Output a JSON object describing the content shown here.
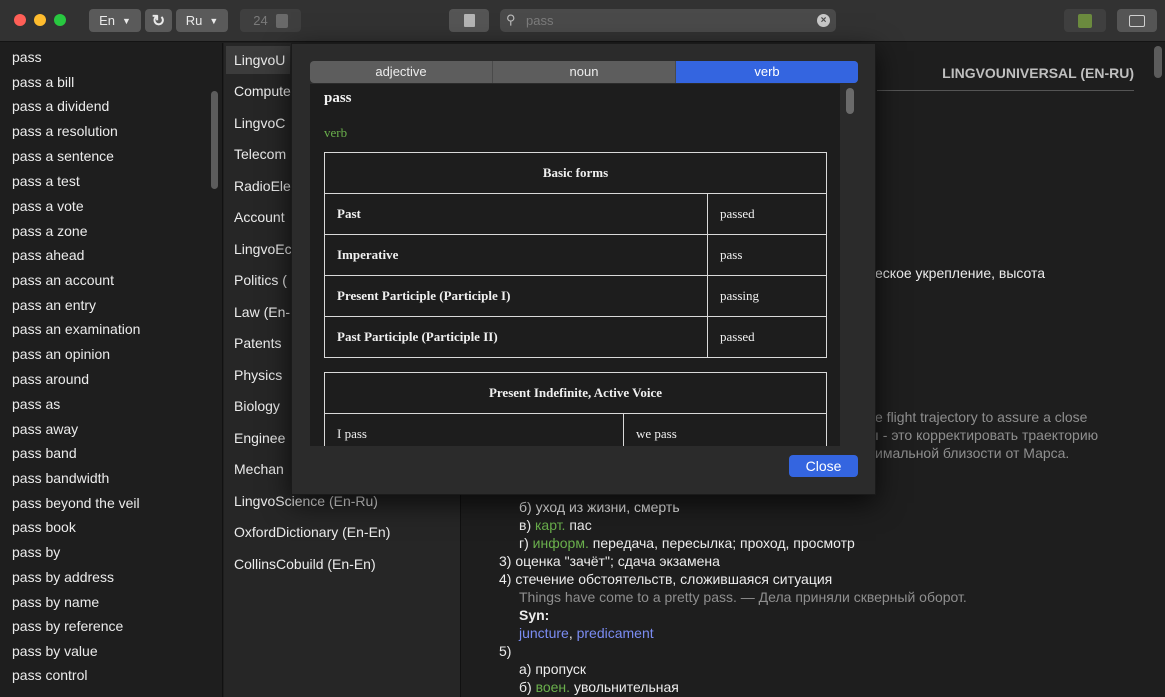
{
  "toolbar": {
    "source_lang": "En",
    "target_lang": "Ru",
    "font_size": "24",
    "search_value": "pass",
    "accent_color": "#3465e0"
  },
  "word_list": [
    "pass",
    "pass a bill",
    "pass a dividend",
    "pass a resolution",
    "pass a sentence",
    "pass a test",
    "pass a vote",
    "pass a zone",
    "pass ahead",
    "pass an account",
    "pass an entry",
    "pass an examination",
    "pass an opinion",
    "pass around",
    "pass as",
    "pass away",
    "pass band",
    "pass bandwidth",
    "pass beyond the veil",
    "pass book",
    "pass by",
    "pass by address",
    "pass by name",
    "pass by reference",
    "pass by value",
    "pass control"
  ],
  "dictionaries": [
    "LingvoU",
    "Compute",
    "LingvoC",
    "Telecom",
    "RadioEle",
    "Account",
    "LingvoEc",
    "Politics (",
    "Law (En-",
    "Patents",
    "Physics",
    "Biology",
    "Enginee",
    "Mechan",
    "LingvoScience (En-Ru)",
    "OxfordDictionary (En-En)",
    "CollinsCobuild (En-En)"
  ],
  "article": {
    "header": "LINGVOUNIVERSAL (EN-RU)",
    "frag1": "еское укрепление, высота",
    "frag2": "e flight trajectory to assure a close",
    "frag3": "ı - это корректировать траекторию",
    "frag4": "имальной близости от Марса.",
    "l_b": "б) уход из жизни, смерть",
    "l_v_label": "в) ",
    "l_v_tag": "карт.",
    "l_v_text": " пас",
    "l_g_label": "г) ",
    "l_g_tag": "информ.",
    "l_g_text": " передача, пересылка; проход, просмотр",
    "l3": "3) оценка \"зачёт\"; сдача экзамена",
    "l4": "4) стечение обстоятельств, сложившаяся ситуация",
    "example": "Things have come to a pretty pass. — Дела приняли скверный оборот.",
    "syn_label": "Syn:",
    "syn1": "juncture",
    "syn_sep": ", ",
    "syn2": "predicament",
    "l5": "5)",
    "l5a": "а) пропуск",
    "l5b_label": "б) ",
    "l5b_tag": "воен.",
    "l5b_text": " увольнительная"
  },
  "modal": {
    "tabs": [
      "adjective",
      "noun",
      "verb"
    ],
    "active_tab": "verb",
    "word": "pass",
    "pos": "verb",
    "basic_forms": {
      "title": "Basic forms",
      "rows": [
        {
          "form": "Past",
          "value": "passed"
        },
        {
          "form": "Imperative",
          "value": "pass"
        },
        {
          "form": "Present Participle (Participle I)",
          "value": "passing"
        },
        {
          "form": "Past Participle (Participle II)",
          "value": "passed"
        }
      ]
    },
    "present_indefinite": {
      "title": "Present Indefinite, Active Voice",
      "rows": [
        [
          "I pass",
          "we pass"
        ]
      ]
    },
    "close_label": "Close"
  }
}
